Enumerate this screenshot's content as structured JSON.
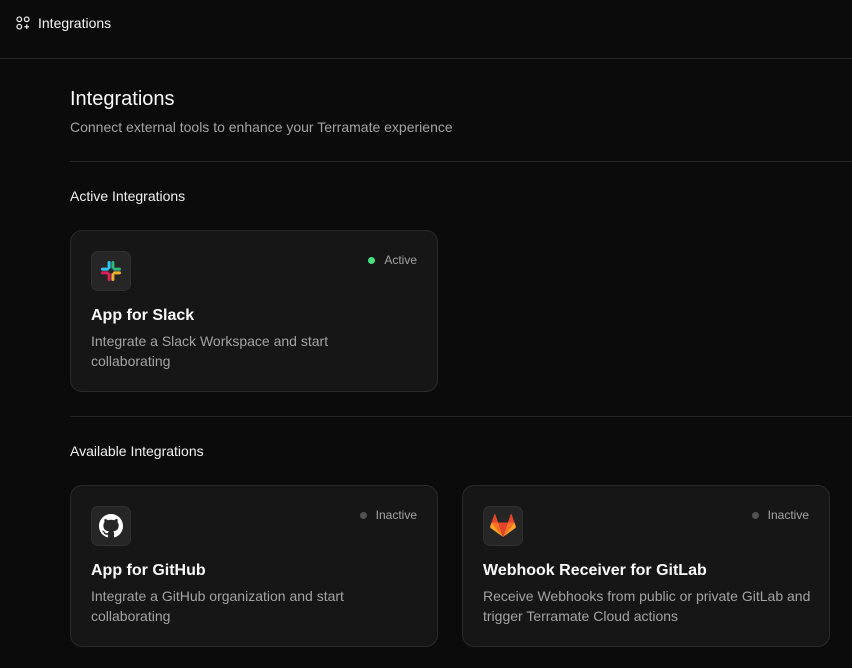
{
  "topbar": {
    "breadcrumb_label": "Integrations",
    "breadcrumb_icon": "integrations-icon"
  },
  "page": {
    "title": "Integrations",
    "subtitle": "Connect external tools to enhance your Terramate experience"
  },
  "sections": {
    "active": {
      "title": "Active Integrations",
      "cards": [
        {
          "title": "App for Slack",
          "description": "Integrate a Slack Workspace and start collaborating",
          "status": "Active",
          "status_color": "#4ade80",
          "icon": "slack-logo-icon"
        }
      ]
    },
    "available": {
      "title": "Available Integrations",
      "cards": [
        {
          "title": "App for GitHub",
          "description": "Integrate a GitHub organization and start collaborating",
          "status": "Inactive",
          "status_color": "#525252",
          "icon": "github-logo-icon"
        },
        {
          "title": "Webhook Receiver for GitLab",
          "description": "Receive Webhooks from public or private GitLab and trigger Terramate Cloud actions",
          "status": "Inactive",
          "status_color": "#525252",
          "icon": "gitlab-logo-icon"
        }
      ]
    }
  },
  "colors": {
    "background": "#0b0b0b",
    "card_background": "#161616",
    "border": "#2a2a2a",
    "muted_text": "#a3a3a3",
    "active_green": "#4ade80"
  }
}
